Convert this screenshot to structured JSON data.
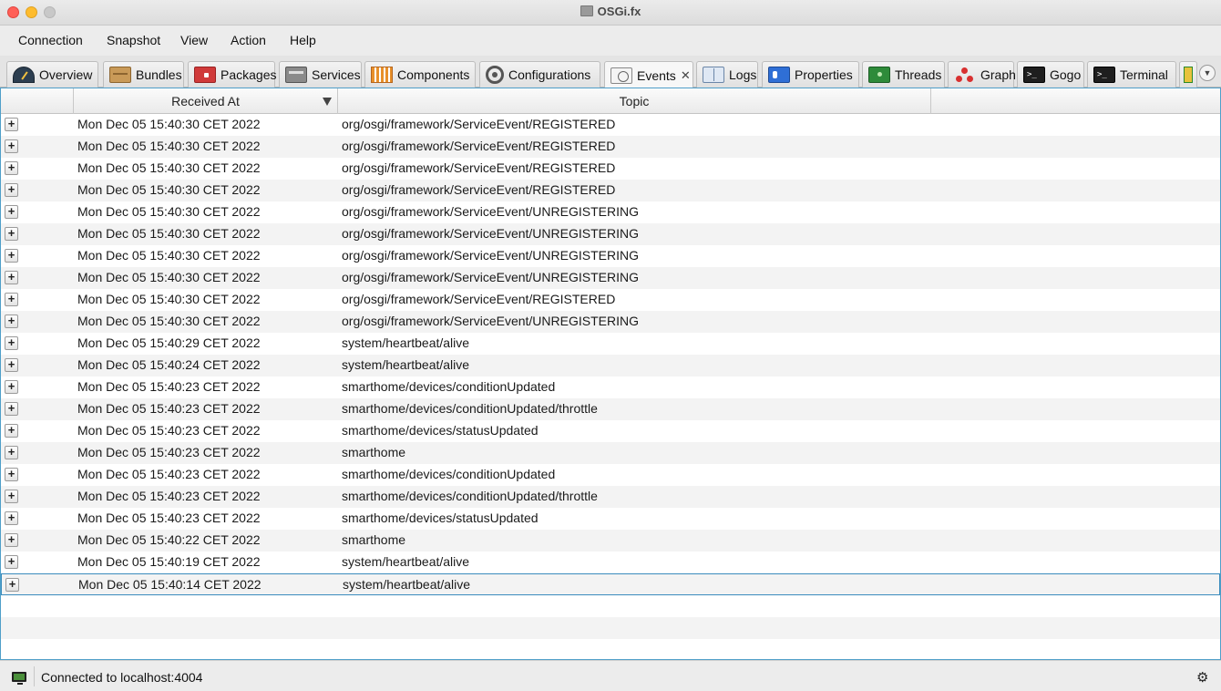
{
  "window": {
    "title": "OSGi.fx"
  },
  "menu": [
    "Connection",
    "Snapshot",
    "View",
    "Action",
    "Help"
  ],
  "tabs": [
    {
      "label": "Overview",
      "icon": "dashboard-gauge-icon"
    },
    {
      "label": "Bundles",
      "icon": "bundle-box-icon"
    },
    {
      "label": "Packages",
      "icon": "package-icon"
    },
    {
      "label": "Services",
      "icon": "server-icon"
    },
    {
      "label": "Components",
      "icon": "components-icon"
    },
    {
      "label": "Configurations",
      "icon": "gear-icon"
    },
    {
      "label": "Events",
      "icon": "events-icon",
      "active": true,
      "close": "✕"
    },
    {
      "label": "Logs",
      "icon": "book-icon"
    },
    {
      "label": "Properties",
      "icon": "id-card-icon"
    },
    {
      "label": "Threads",
      "icon": "chip-icon"
    },
    {
      "label": "Graph",
      "icon": "graph-nodes-icon"
    },
    {
      "label": "Gogo",
      "icon": "terminal-icon"
    },
    {
      "label": "Terminal",
      "icon": "terminal-icon"
    }
  ],
  "table": {
    "columns": [
      "Received At",
      "Topic"
    ],
    "expander_symbol": "+",
    "rows": [
      {
        "received_at": "Mon Dec 05 15:40:30 CET 2022",
        "topic": "org/osgi/framework/ServiceEvent/REGISTERED"
      },
      {
        "received_at": "Mon Dec 05 15:40:30 CET 2022",
        "topic": "org/osgi/framework/ServiceEvent/REGISTERED"
      },
      {
        "received_at": "Mon Dec 05 15:40:30 CET 2022",
        "topic": "org/osgi/framework/ServiceEvent/REGISTERED"
      },
      {
        "received_at": "Mon Dec 05 15:40:30 CET 2022",
        "topic": "org/osgi/framework/ServiceEvent/REGISTERED"
      },
      {
        "received_at": "Mon Dec 05 15:40:30 CET 2022",
        "topic": "org/osgi/framework/ServiceEvent/UNREGISTERING"
      },
      {
        "received_at": "Mon Dec 05 15:40:30 CET 2022",
        "topic": "org/osgi/framework/ServiceEvent/UNREGISTERING"
      },
      {
        "received_at": "Mon Dec 05 15:40:30 CET 2022",
        "topic": "org/osgi/framework/ServiceEvent/UNREGISTERING"
      },
      {
        "received_at": "Mon Dec 05 15:40:30 CET 2022",
        "topic": "org/osgi/framework/ServiceEvent/UNREGISTERING"
      },
      {
        "received_at": "Mon Dec 05 15:40:30 CET 2022",
        "topic": "org/osgi/framework/ServiceEvent/REGISTERED"
      },
      {
        "received_at": "Mon Dec 05 15:40:30 CET 2022",
        "topic": "org/osgi/framework/ServiceEvent/UNREGISTERING"
      },
      {
        "received_at": "Mon Dec 05 15:40:29 CET 2022",
        "topic": "system/heartbeat/alive"
      },
      {
        "received_at": "Mon Dec 05 15:40:24 CET 2022",
        "topic": "system/heartbeat/alive"
      },
      {
        "received_at": "Mon Dec 05 15:40:23 CET 2022",
        "topic": "smarthome/devices/conditionUpdated"
      },
      {
        "received_at": "Mon Dec 05 15:40:23 CET 2022",
        "topic": "smarthome/devices/conditionUpdated/throttle"
      },
      {
        "received_at": "Mon Dec 05 15:40:23 CET 2022",
        "topic": "smarthome/devices/statusUpdated"
      },
      {
        "received_at": "Mon Dec 05 15:40:23 CET 2022",
        "topic": "smarthome"
      },
      {
        "received_at": "Mon Dec 05 15:40:23 CET 2022",
        "topic": "smarthome/devices/conditionUpdated"
      },
      {
        "received_at": "Mon Dec 05 15:40:23 CET 2022",
        "topic": "smarthome/devices/conditionUpdated/throttle"
      },
      {
        "received_at": "Mon Dec 05 15:40:23 CET 2022",
        "topic": "smarthome/devices/statusUpdated"
      },
      {
        "received_at": "Mon Dec 05 15:40:22 CET 2022",
        "topic": "smarthome"
      },
      {
        "received_at": "Mon Dec 05 15:40:19 CET 2022",
        "topic": "system/heartbeat/alive"
      },
      {
        "received_at": "Mon Dec 05 15:40:14 CET 2022",
        "topic": "system/heartbeat/alive",
        "selected": true
      }
    ]
  },
  "status": {
    "text": "Connected to localhost:4004"
  },
  "colors": {
    "selection_border": "#3b8cbd",
    "table_border": "#4f9fc9",
    "alt_row": "#f3f3f3"
  }
}
